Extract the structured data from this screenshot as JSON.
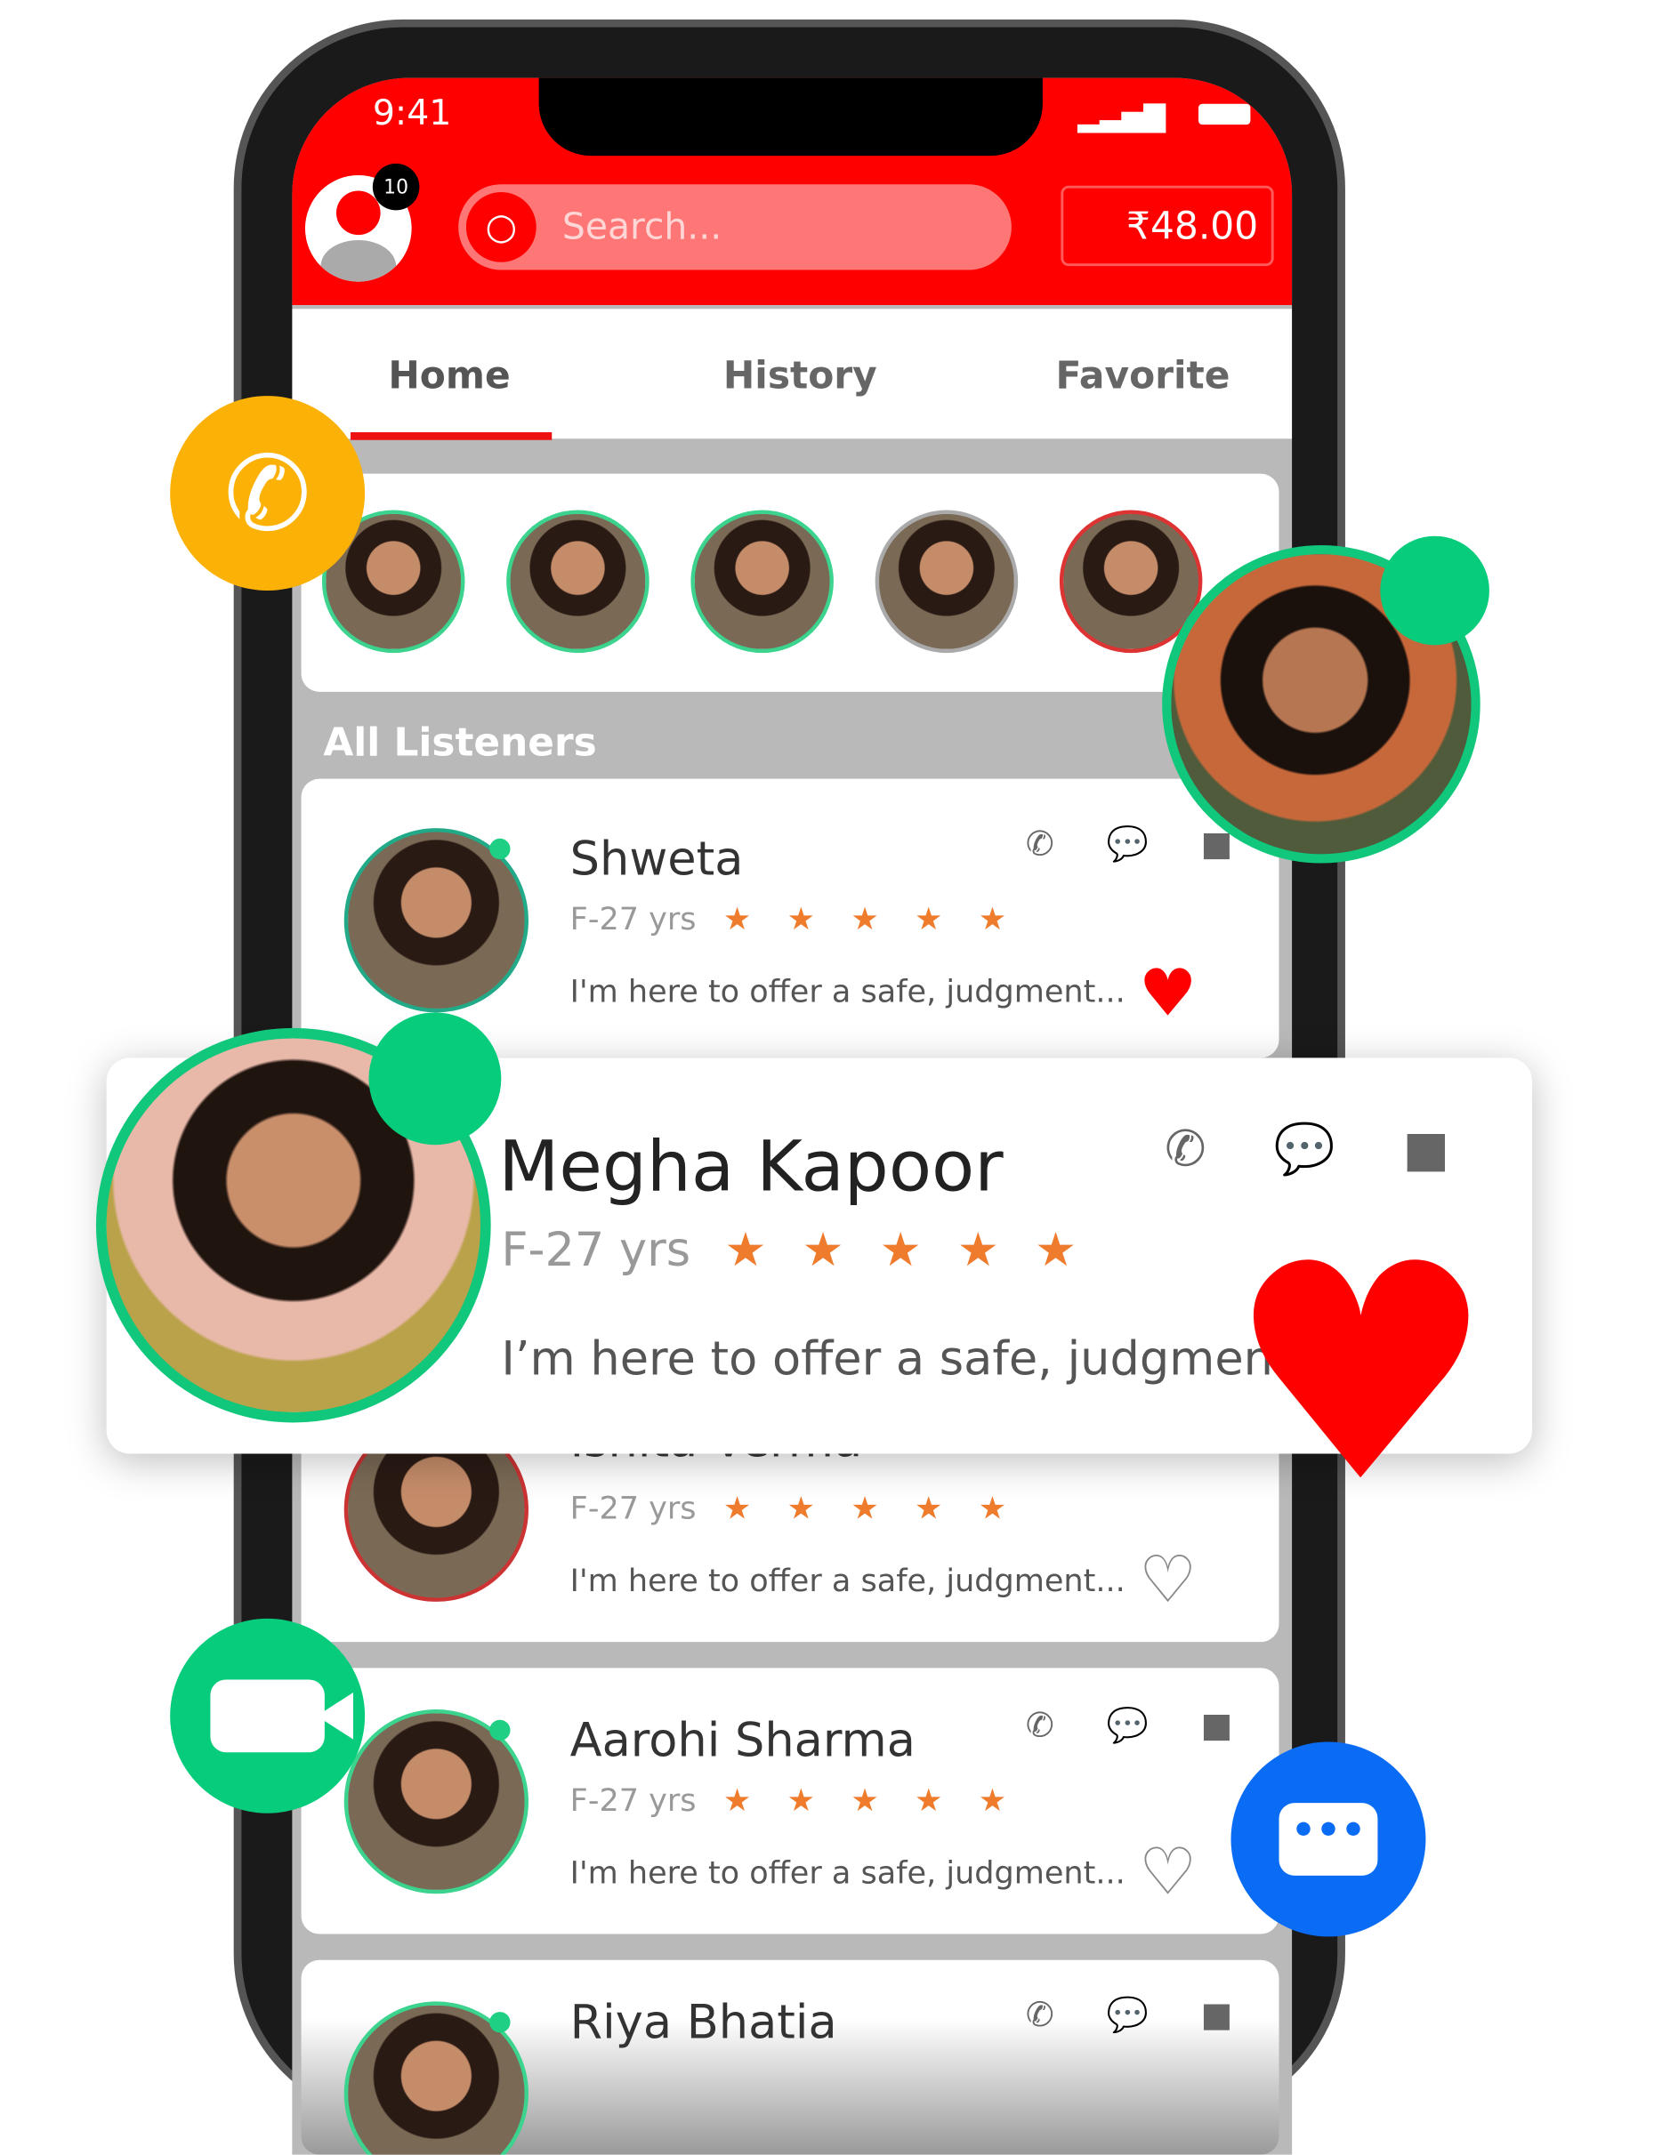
{
  "status_bar": {
    "time": "9:41"
  },
  "header": {
    "notification_count": "10",
    "search_placeholder": "Search...",
    "wallet_balance": "₹48.00"
  },
  "tabs": [
    {
      "label": "Home",
      "active": true
    },
    {
      "label": "History"
    },
    {
      "label": "Favorite"
    }
  ],
  "section_title": "All Listeners",
  "stories": [
    {
      "status": "online"
    },
    {
      "status": "online"
    },
    {
      "status": "online"
    },
    {
      "status": "offline"
    },
    {
      "status": "busy"
    }
  ],
  "listeners": [
    {
      "name": "Shweta",
      "age": "F-27 yrs",
      "rating": 5,
      "bio": "I'm here to offer a safe, judgment...",
      "favorite": true
    },
    {
      "name": "Ishita Verma",
      "age": "F-27 yrs",
      "rating": 5,
      "bio": "I'm here to offer a safe, judgment...",
      "favorite": false
    },
    {
      "name": "Aarohi Sharma",
      "age": "F-27 yrs",
      "rating": 5,
      "bio": "I'm here to offer a safe, judgment...",
      "favorite": false
    },
    {
      "name": "Riya Bhatia"
    }
  ],
  "featured": {
    "name": "Megha Kapoor",
    "age": "F-27 yrs",
    "rating": 5,
    "bio": "I’m here to offer a safe, judgment",
    "favorite": true
  },
  "colors": {
    "brand": "#ff0000",
    "online": "#1fcf84",
    "star": "#ef7b2c",
    "call": "#fbb106",
    "video": "#06cc7c",
    "chat": "#0a6cf5"
  },
  "icons": {
    "stars": "★ ★ ★ ★ ★",
    "actions": "✆ 💬 ■"
  }
}
